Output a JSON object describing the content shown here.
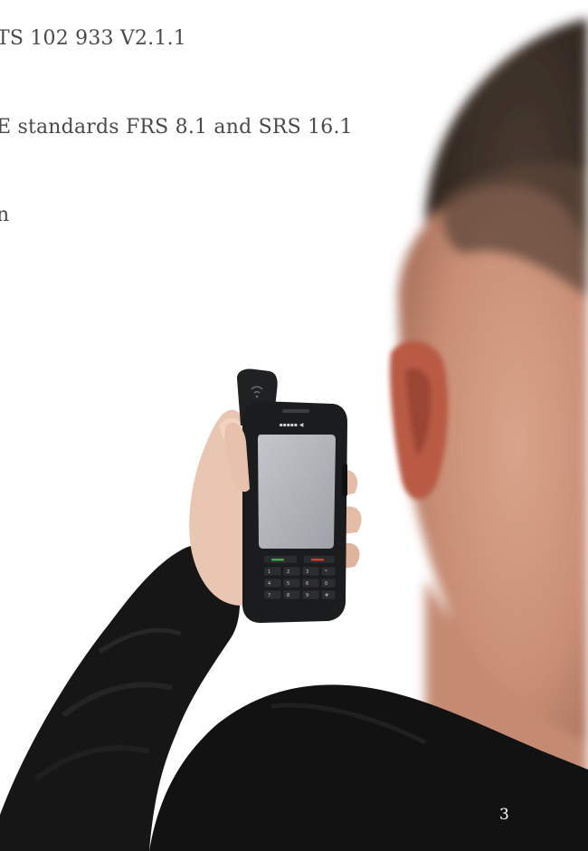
{
  "document": {
    "lines": [
      "TS 102 933 V2.1.1",
      "E standards FRS 8.1 and SRS 16.1",
      "n"
    ],
    "page_number": "3"
  },
  "photo": {
    "subject": "person holding rugged satellite phone",
    "device_screen_color": "#a9adb2",
    "device_body_color": "#1b1c1e",
    "sleeve_color": "#151515",
    "hair_color": "#3a2e27",
    "skin_color": "#d9a58c"
  }
}
